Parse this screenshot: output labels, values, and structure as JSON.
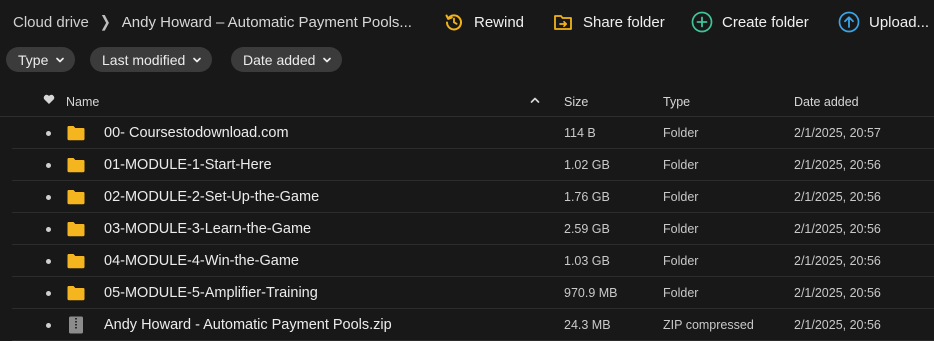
{
  "breadcrumb": {
    "root": "Cloud drive",
    "current": "Andy Howard – Automatic Payment Pools..."
  },
  "toolbar": {
    "rewind": "Rewind",
    "share_folder": "Share folder",
    "create_folder": "Create folder",
    "upload": "Upload..."
  },
  "filters": {
    "type": "Type",
    "last_modified": "Last modified",
    "date_added": "Date added"
  },
  "columns": {
    "name": "Name",
    "size": "Size",
    "type": "Type",
    "date_added": "Date added"
  },
  "rows": [
    {
      "name": "00- Coursestodownload.com",
      "size": "114 B",
      "type": "Folder",
      "date": "2/1/2025, 20:57",
      "icon": "folder-icon"
    },
    {
      "name": "01-MODULE-1-Start-Here",
      "size": "1.02 GB",
      "type": "Folder",
      "date": "2/1/2025, 20:56",
      "icon": "folder-icon"
    },
    {
      "name": "02-MODULE-2-Set-Up-the-Game",
      "size": "1.76 GB",
      "type": "Folder",
      "date": "2/1/2025, 20:56",
      "icon": "folder-icon"
    },
    {
      "name": "03-MODULE-3-Learn-the-Game",
      "size": "2.59 GB",
      "type": "Folder",
      "date": "2/1/2025, 20:56",
      "icon": "folder-icon"
    },
    {
      "name": "04-MODULE-4-Win-the-Game",
      "size": "1.03 GB",
      "type": "Folder",
      "date": "2/1/2025, 20:56",
      "icon": "folder-icon"
    },
    {
      "name": "05-MODULE-5-Amplifier-Training",
      "size": "970.9 MB",
      "type": "Folder",
      "date": "2/1/2025, 20:56",
      "icon": "folder-icon"
    },
    {
      "name": "Andy Howard - Automatic Payment Pools.zip",
      "size": "24.3 MB",
      "type": "ZIP compressed",
      "date": "2/1/2025, 20:56",
      "icon": "zip-file-icon"
    }
  ],
  "colors": {
    "background": "#181818",
    "chip": "#3b3b3b",
    "rewind_accent": "#f2b318",
    "share_accent": "#f2b318",
    "create_accent": "#3fc49a",
    "upload_accent": "#3aa4e8",
    "folder": "#f5b51f"
  }
}
